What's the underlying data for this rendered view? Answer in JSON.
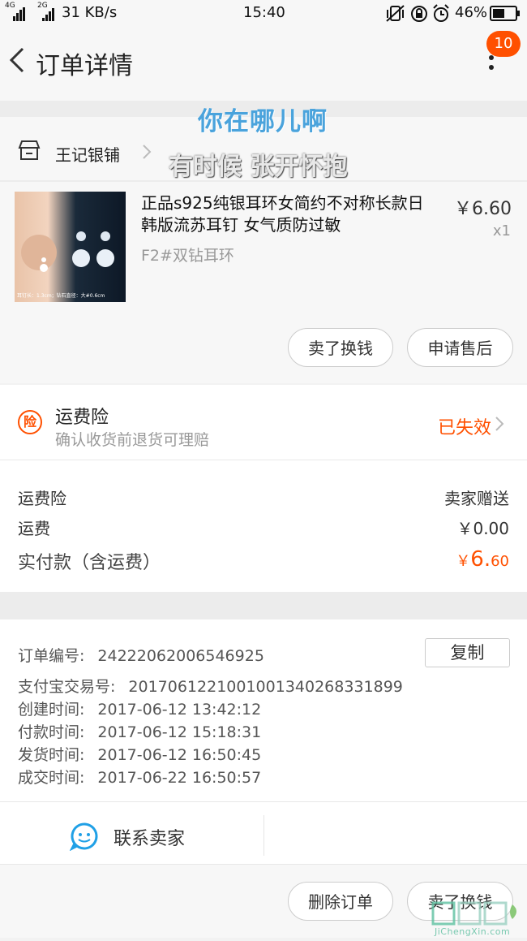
{
  "status_bar": {
    "network_left": "4G",
    "network_right": "2G",
    "speed": "31 KB/s",
    "time": "15:40",
    "battery": "46%"
  },
  "header": {
    "title": "订单详情",
    "badge": "10"
  },
  "overlay": {
    "line1": "你在哪儿啊",
    "line2": "有时候 张开怀抱"
  },
  "shop": {
    "name": "王记银铺"
  },
  "product": {
    "title": "正品s925纯银耳环女简约不对称长款日韩版流苏耳钉 女气质防过敏",
    "sku": "F2#双钻耳环",
    "price": "￥6.60",
    "quantity": "x1",
    "image_caption": "耳钉长：1.3cm；钻石直径：大#0.6cm"
  },
  "product_actions": {
    "sell_label": "卖了换钱",
    "after_sale_label": "申请售后"
  },
  "insurance": {
    "icon_char": "险",
    "title": "运费险",
    "subtitle": "确认收货前退货可理赔",
    "status": "已失效"
  },
  "costs": {
    "rows": [
      {
        "label": "运费险",
        "value": "卖家赠送"
      },
      {
        "label": "运费",
        "value": "￥0.00"
      }
    ],
    "paid_label": "实付款（含运费）",
    "paid_currency": "￥",
    "paid_int": "6.",
    "paid_dec": "60"
  },
  "order_info": {
    "copy_label": "复制",
    "rows": [
      {
        "label": "订单编号:",
        "value": "24222062006546925"
      },
      {
        "label": "支付宝交易号:",
        "value": "20170612210010013402683318​99"
      },
      {
        "label": "创建时间:",
        "value": "2017-06-12 13:42:12"
      },
      {
        "label": "付款时间:",
        "value": "2017-06-12 15:18:31"
      },
      {
        "label": "发货时间:",
        "value": "2017-06-12 16:50:45"
      },
      {
        "label": "成交时间:",
        "value": "2017-06-22 16:50:57"
      }
    ]
  },
  "contact": {
    "label": "联系卖家"
  },
  "bottom_actions": {
    "delete_label": "删除订单",
    "sell_label": "卖了换钱"
  },
  "watermark": {
    "text": "JiChengXin.com"
  },
  "colors": {
    "accent": "#ff5000",
    "overlay_blue": "#4aa3dc",
    "contact_blue": "#20a0e6"
  }
}
